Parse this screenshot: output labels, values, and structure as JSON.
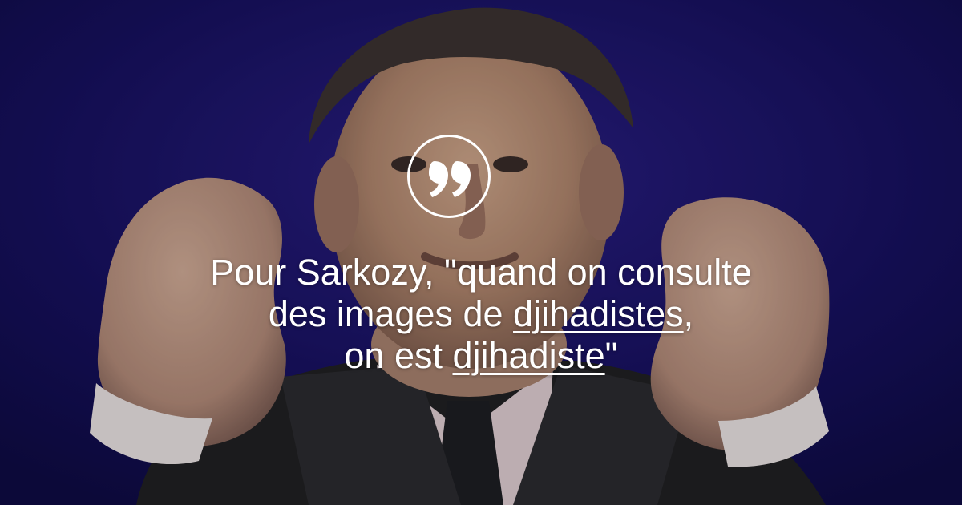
{
  "image": {
    "description_icon": "quote-icon",
    "background_color": "#14105a",
    "text_color": "#ffffff",
    "quote": {
      "line1": "Pour Sarkozy, \"quand on consulte",
      "line2_start": "des images de ",
      "line2_keyword": "djihadistes",
      "line2_end": ",",
      "line3_start": "on est ",
      "line3_keyword": "djihadiste",
      "line3_end": "\""
    }
  }
}
